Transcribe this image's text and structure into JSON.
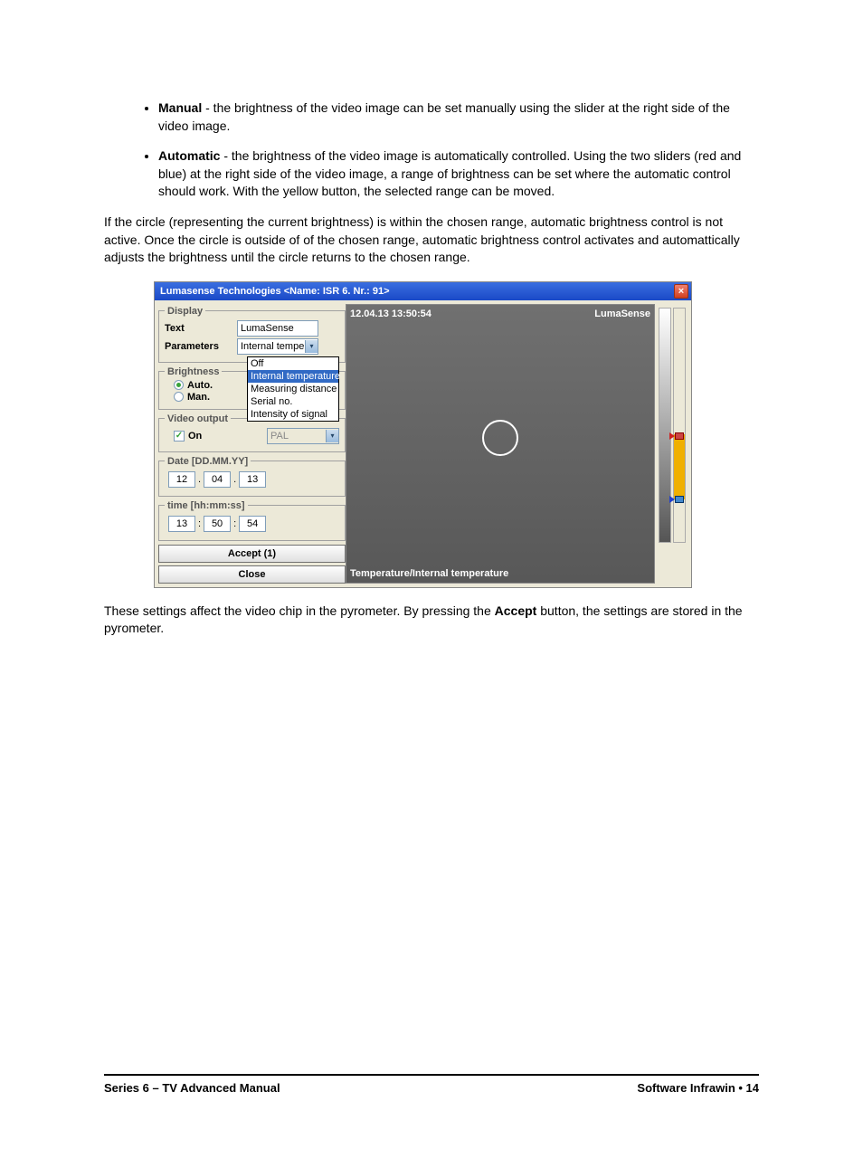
{
  "bullets": {
    "manual_label": "Manual",
    "manual_text": " - the brightness of the video image can be set manually using the slider at the right side of the video image.",
    "auto_label": "Automatic",
    "auto_text": " - the brightness of the video image is automatically controlled. Using the two sliders (red and blue) at the right side of the video image, a range of brightness can be set where the automatic control should work. With the yellow button, the selected range can be moved."
  },
  "para1": "If the circle (representing the current brightness) is within the chosen range, automatic brightness control is not active. Once the circle is outside of of the chosen range, automatic brightness control activates and automattically adjusts the brightness until the circle returns to the chosen range.",
  "para2_a": "These settings affect the video chip in the pyrometer. By pressing the ",
  "para2_bold": "Accept",
  "para2_b": " button, the settings are stored in the pyrometer.",
  "window": {
    "title": "Lumasense Technologies   <Name: ISR 6. Nr.: 91>",
    "groups": {
      "display": "Display",
      "brightness": "Brightness",
      "video_output": "Video output",
      "date": "Date [DD.MM.YY]",
      "time": "time [hh:mm:ss]"
    },
    "labels": {
      "text": "Text",
      "parameters": "Parameters",
      "auto": "Auto.",
      "man": "Man.",
      "on": "On"
    },
    "text_value": "LumaSense",
    "parameters_value": "Internal tempe",
    "dropdown": {
      "options": [
        "Off",
        "Internal temperature",
        "Measuring distance",
        "Serial no.",
        "Intensity of signal"
      ],
      "selected_index": 1
    },
    "video_std": "PAL",
    "date": {
      "d": "12",
      "m": "04",
      "y": "13"
    },
    "time": {
      "h": "13",
      "m": "50",
      "s": "54"
    },
    "buttons": {
      "accept": "Accept (1)",
      "close": "Close"
    },
    "preview": {
      "left_text": "12.04.13   13:50:54",
      "right_text": "LumaSense",
      "bottom_text": "Temperature/Internal temperature"
    }
  },
  "footer": {
    "left": "Series 6 – TV Advanced Manual",
    "right_a": "Software Infrawin ",
    "right_b": "•  14"
  }
}
